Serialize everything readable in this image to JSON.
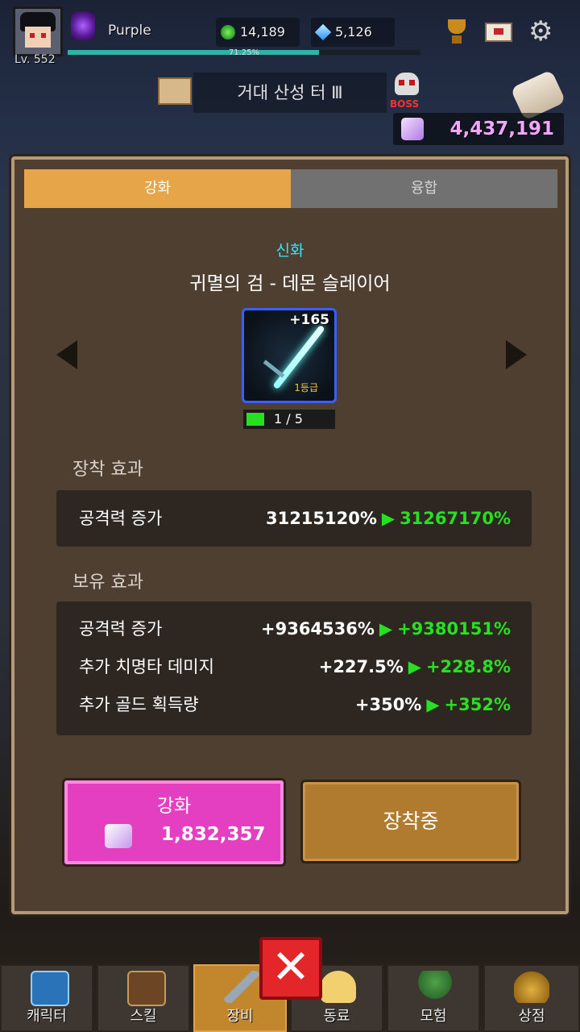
{
  "player": {
    "name": "Purple",
    "level": "Lv. 552",
    "exp_percent": "71.25%",
    "exp_fraction": 0.7125
  },
  "resources": {
    "green_gems": "14,189",
    "diamonds": "5,126",
    "cubes": "4,437,191"
  },
  "stage": {
    "name": "거대 산성 터 Ⅲ",
    "boss_label": "BOSS"
  },
  "tabs": {
    "upgrade": "강화",
    "fusion": "융합"
  },
  "item": {
    "grade": "신화",
    "name": "귀멸의 검 - 데몬 슬레이어",
    "enhance_level": "+165",
    "tier": "1등급",
    "count": "1 / 5",
    "count_fraction": 0.2
  },
  "equip_effect": {
    "title": "장착 효과",
    "rows": [
      {
        "label": "공격력 증가",
        "current": "31215120%",
        "next": "31267170%"
      }
    ]
  },
  "owned_effect": {
    "title": "보유 효과",
    "rows": [
      {
        "label": "공격력 증가",
        "current": "+9364536%",
        "next": "+9380151%"
      },
      {
        "label": "추가 치명타 데미지",
        "current": "+227.5%",
        "next": "+228.8%"
      },
      {
        "label": "추가 골드 획득량",
        "current": "+350%",
        "next": "+352%"
      }
    ]
  },
  "buttons": {
    "upgrade_label": "강화",
    "upgrade_cost": "1,832,357",
    "equipped_label": "장착중",
    "close_symbol": "✕"
  },
  "arrow_symbol": "▶",
  "nav": [
    {
      "label": "캐릭터",
      "icon": "exp-icon"
    },
    {
      "label": "스킬",
      "icon": "spellbook-icon"
    },
    {
      "label": "장비",
      "icon": "sword-icon"
    },
    {
      "label": "동료",
      "icon": "companion-icon"
    },
    {
      "label": "모험",
      "icon": "tree-icon"
    },
    {
      "label": "상점",
      "icon": "gold-bag-icon"
    }
  ],
  "colors": {
    "accent_orange": "#e6a548",
    "upgrade_pink": "#e43fc0",
    "increase_green": "#27e021",
    "grade_cyan": "#32e5ff",
    "cube_pink": "#f4a6ff"
  }
}
